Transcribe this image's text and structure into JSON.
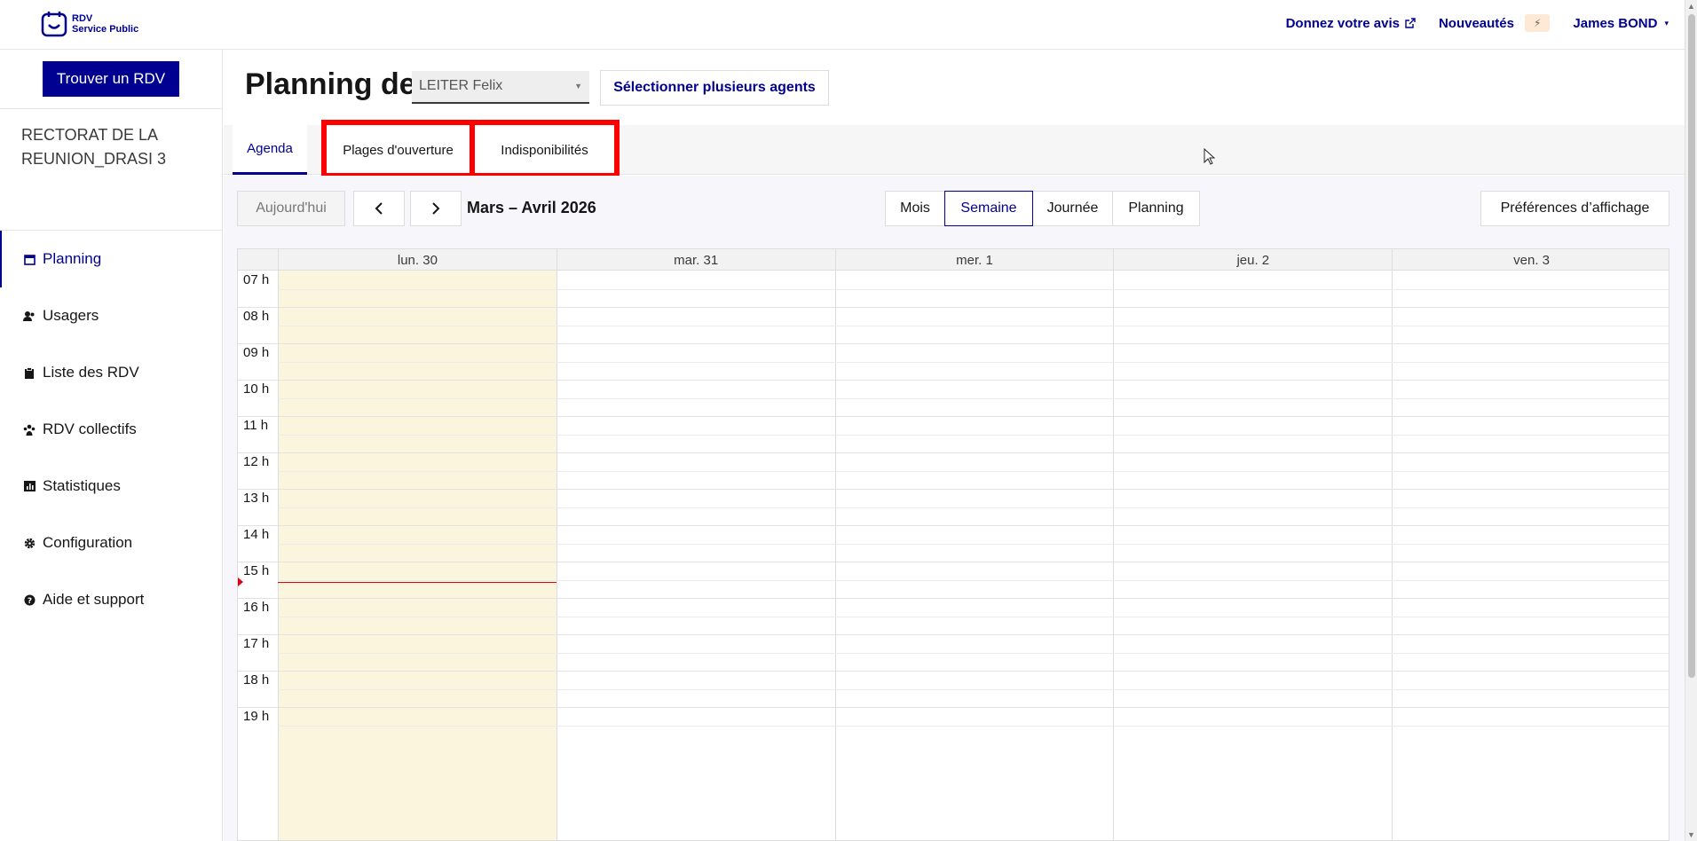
{
  "header": {
    "logo_line1": "RDV",
    "logo_line2": "Service Public",
    "feedback_link": "Donnez votre avis",
    "news_link": "Nouveautés",
    "news_badge": "⚡",
    "user_menu": "James BOND"
  },
  "sidebar": {
    "find_button": "Trouver un RDV",
    "organization_line1": "RECTORAT DE LA",
    "organization_line2": "REUNION_DRASI 3",
    "items": [
      {
        "label": "Planning",
        "icon": "calendar-icon",
        "active": true
      },
      {
        "label": "Usagers",
        "icon": "users-icon",
        "active": false
      },
      {
        "label": "Liste des RDV",
        "icon": "clipboard-icon",
        "active": false
      },
      {
        "label": "RDV collectifs",
        "icon": "group-icon",
        "active": false
      },
      {
        "label": "Statistiques",
        "icon": "chart-icon",
        "active": false
      },
      {
        "label": "Configuration",
        "icon": "gear-icon",
        "active": false
      },
      {
        "label": "Aide et support",
        "icon": "help-icon",
        "active": false
      }
    ]
  },
  "main": {
    "title": "Planning de",
    "agent_select_value": "LEITER Felix",
    "multi_agents_button": "Sélectionner plusieurs agents",
    "tabs": [
      {
        "label": "Agenda",
        "active": true
      },
      {
        "label": "Plages d'ouverture",
        "active": false
      },
      {
        "label": "Indisponibilités",
        "active": false
      }
    ]
  },
  "calendar": {
    "today_button": "Aujourd'hui",
    "range_title": "Mars – Avril 2026",
    "views": [
      {
        "label": "Mois",
        "active": false
      },
      {
        "label": "Semaine",
        "active": true
      },
      {
        "label": "Journée",
        "active": false
      },
      {
        "label": "Planning",
        "active": false
      }
    ],
    "prefs_button": "Préférences d’affichage",
    "days": [
      "lun. 30",
      "mar. 31",
      "mer. 1",
      "jeu. 2",
      "ven. 3"
    ],
    "hours": [
      "07 h",
      "08 h",
      "09 h",
      "10 h",
      "11 h",
      "12 h",
      "13 h",
      "14 h",
      "15 h",
      "16 h",
      "17 h",
      "18 h",
      "19 h"
    ],
    "today_index": 0,
    "now_time": "15:33"
  },
  "colors": {
    "primary": "#000091",
    "today_bg": "#faf5dc",
    "now_line": "#e1000f",
    "highlight_box": "#ff0000"
  }
}
